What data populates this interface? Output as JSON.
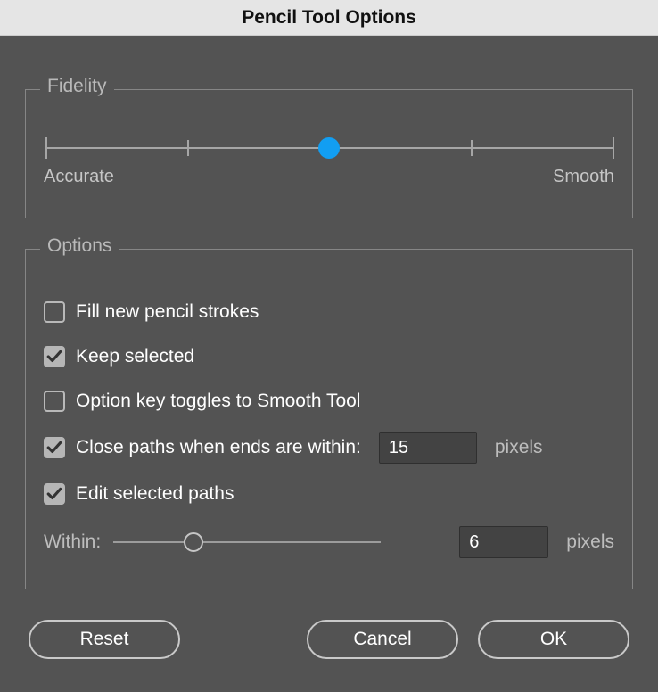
{
  "title": "Pencil Tool Options",
  "fidelity": {
    "legend": "Fidelity",
    "left_label": "Accurate",
    "right_label": "Smooth",
    "ticks": 5,
    "value_index": 2
  },
  "options": {
    "legend": "Options",
    "fill_strokes": {
      "label": "Fill new pencil strokes",
      "checked": false
    },
    "keep_selected": {
      "label": "Keep selected",
      "checked": true
    },
    "option_smooth": {
      "label": "Option key toggles to Smooth Tool",
      "checked": false
    },
    "close_paths": {
      "label": "Close paths when ends are within:",
      "checked": true,
      "value": "15",
      "unit": "pixels"
    },
    "edit_paths": {
      "label": "Edit selected paths",
      "checked": true
    },
    "within": {
      "label": "Within:",
      "value": "6",
      "unit": "pixels",
      "slider_percent": 30
    }
  },
  "buttons": {
    "reset": "Reset",
    "cancel": "Cancel",
    "ok": "OK"
  }
}
